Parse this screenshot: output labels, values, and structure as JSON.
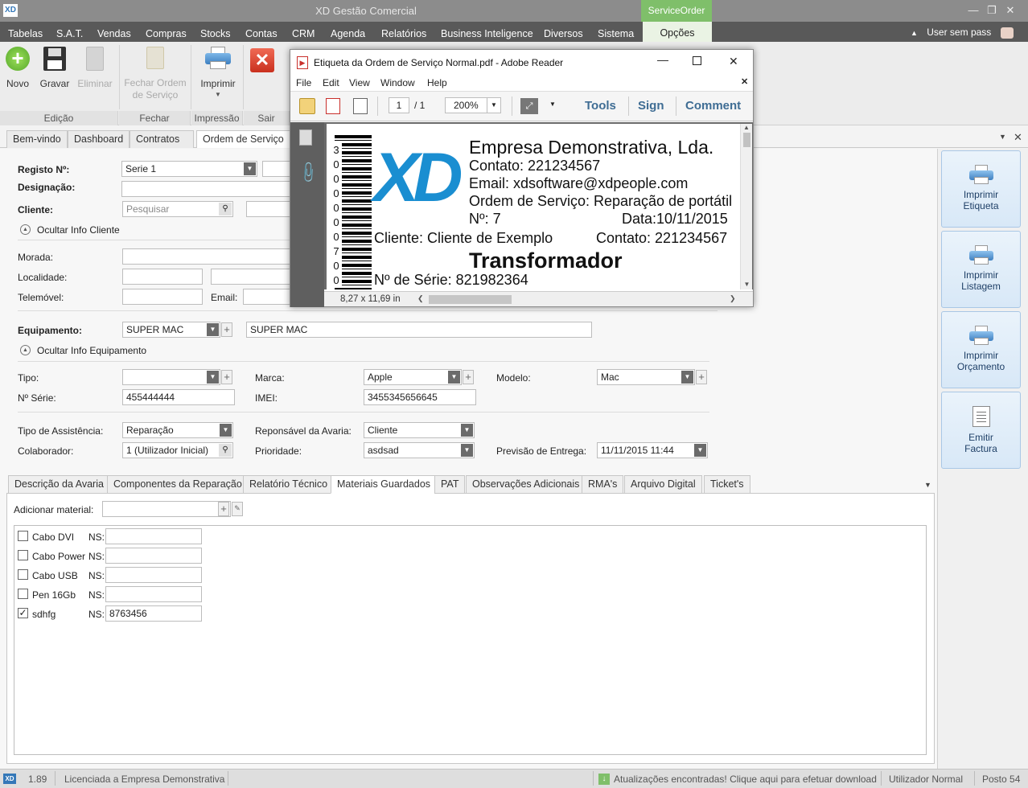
{
  "app": {
    "logo": "XD",
    "title": "XD Gestão Comercial",
    "context_tab": "ServiceOrder",
    "window_controls": [
      "minimize-icon",
      "restore-icon",
      "close-icon"
    ]
  },
  "menu": {
    "items": [
      "Tabelas",
      "S.A.T.",
      "Vendas",
      "Compras",
      "Stocks",
      "Contas",
      "CRM",
      "Agenda",
      "Relatórios",
      "Business Inteligence",
      "Diversos",
      "Sistema",
      "Opções"
    ],
    "user": "User sem pass"
  },
  "ribbon": {
    "buttons": {
      "novo": "Novo",
      "gravar": "Gravar",
      "eliminar": "Eliminar",
      "fechar_line1": "Fechar Ordem",
      "fechar_line2": "de Serviço",
      "imprimir": "Imprimir"
    },
    "groups": {
      "edicao": "Edição",
      "fechar": "Fechar",
      "impressao": "Impressão",
      "sair": "Sair"
    }
  },
  "doc_tabs": [
    "Bem-vindo",
    "Dashboard",
    "Contratos",
    "Ordem de Serviço"
  ],
  "form": {
    "registo_label": "Registo Nº:",
    "registo_value": "Serie 1",
    "designacao_label": "Designação:",
    "cliente_label": "Cliente:",
    "cliente_placeholder": "Pesquisar",
    "ocultar_cliente": "Ocultar Info Cliente",
    "morada_label": "Morada:",
    "localidade_label": "Localidade:",
    "telemovel_label": "Telemóvel:",
    "email_label": "Email:",
    "equipamento_label": "Equipamento:",
    "equipamento_value": "SUPER MAC",
    "equipamento_desc": "SUPER MAC",
    "ocultar_equipamento": "Ocultar Info Equipamento",
    "tipo_label": "Tipo:",
    "marca_label": "Marca:",
    "marca_value": "Apple",
    "modelo_label": "Modelo:",
    "modelo_value": "Mac",
    "nserie_label": "Nº Série:",
    "nserie_value": "455444444",
    "imei_label": "IMEI:",
    "imei_value": "3455345656645",
    "tipo_assistencia_label": "Tipo de Assistência:",
    "tipo_assistencia_value": "Reparação",
    "responsavel_label": "Reponsável da Avaria:",
    "responsavel_value": "Cliente",
    "colaborador_label": "Colaborador:",
    "colaborador_value": "1 (Utilizador Inicial)",
    "prioridade_label": "Prioridade:",
    "prioridade_value": "asdsad",
    "previsao_label": "Previsão de Entrega:",
    "previsao_value": "11/11/2015 11:44"
  },
  "panel_tabs": [
    "Descrição da Avaria",
    "Componentes da Reparação",
    "Relatório Técnico",
    "Materiais Guardados",
    "PAT",
    "Observações Adicionais",
    "RMA's",
    "Arquivo Digital",
    "Ticket's"
  ],
  "materiais": {
    "add_label": "Adicionar material:",
    "ns_label": "NS:",
    "items": [
      {
        "name": "Cabo DVI",
        "checked": false,
        "ns": ""
      },
      {
        "name": "Cabo Power",
        "checked": false,
        "ns": ""
      },
      {
        "name": "Cabo USB",
        "checked": false,
        "ns": ""
      },
      {
        "name": "Pen 16Gb",
        "checked": false,
        "ns": ""
      },
      {
        "name": "sdhfg",
        "checked": true,
        "ns": "8763456"
      }
    ]
  },
  "side_buttons": [
    {
      "l1": "Imprimir",
      "l2": "Etiqueta"
    },
    {
      "l1": "Imprimir",
      "l2": "Listagem"
    },
    {
      "l1": "Imprimir",
      "l2": "Orçamento"
    },
    {
      "l1": "Emitir",
      "l2": "Factura"
    }
  ],
  "status": {
    "version": "1.89",
    "license": "Licenciada a Empresa Demonstrativa",
    "updates": "Atualizações encontradas! Clique aqui para efetuar download",
    "user": "Utilizador Normal",
    "posto": "Posto 54"
  },
  "pdf": {
    "title": "Etiqueta da Ordem de Serviço Normal.pdf - Adobe Reader",
    "menu": [
      "File",
      "Edit",
      "View",
      "Window",
      "Help"
    ],
    "page": "1",
    "page_total": "/ 1",
    "zoom": "200%",
    "tools": "Tools",
    "sign": "Sign",
    "comment": "Comment",
    "page_size": "8,27 x 11,69 in",
    "label": {
      "barcode_text": "3000000700",
      "logo": "XD",
      "company": "Empresa Demonstrativa, Lda.",
      "contato": "Contato: 221234567",
      "email": "Email: xdsoftware@xdpeople.com",
      "ordem_label": "Ordem de Serviço:",
      "ordem_value": "Reparação de portátil",
      "numero": "Nº: 7",
      "data": "Data:10/11/2015",
      "cliente": "Cliente: Cliente de Exemplo",
      "cliente_contato": "Contato: 221234567",
      "equipamento": "Transformador",
      "serie": "Nº de Série: 821982364"
    }
  },
  "colors": {
    "accent_green": "#7fbf6a",
    "menubar": "#595959",
    "titlebar": "#8c8c8c",
    "side_button": "#d8e8f7"
  }
}
